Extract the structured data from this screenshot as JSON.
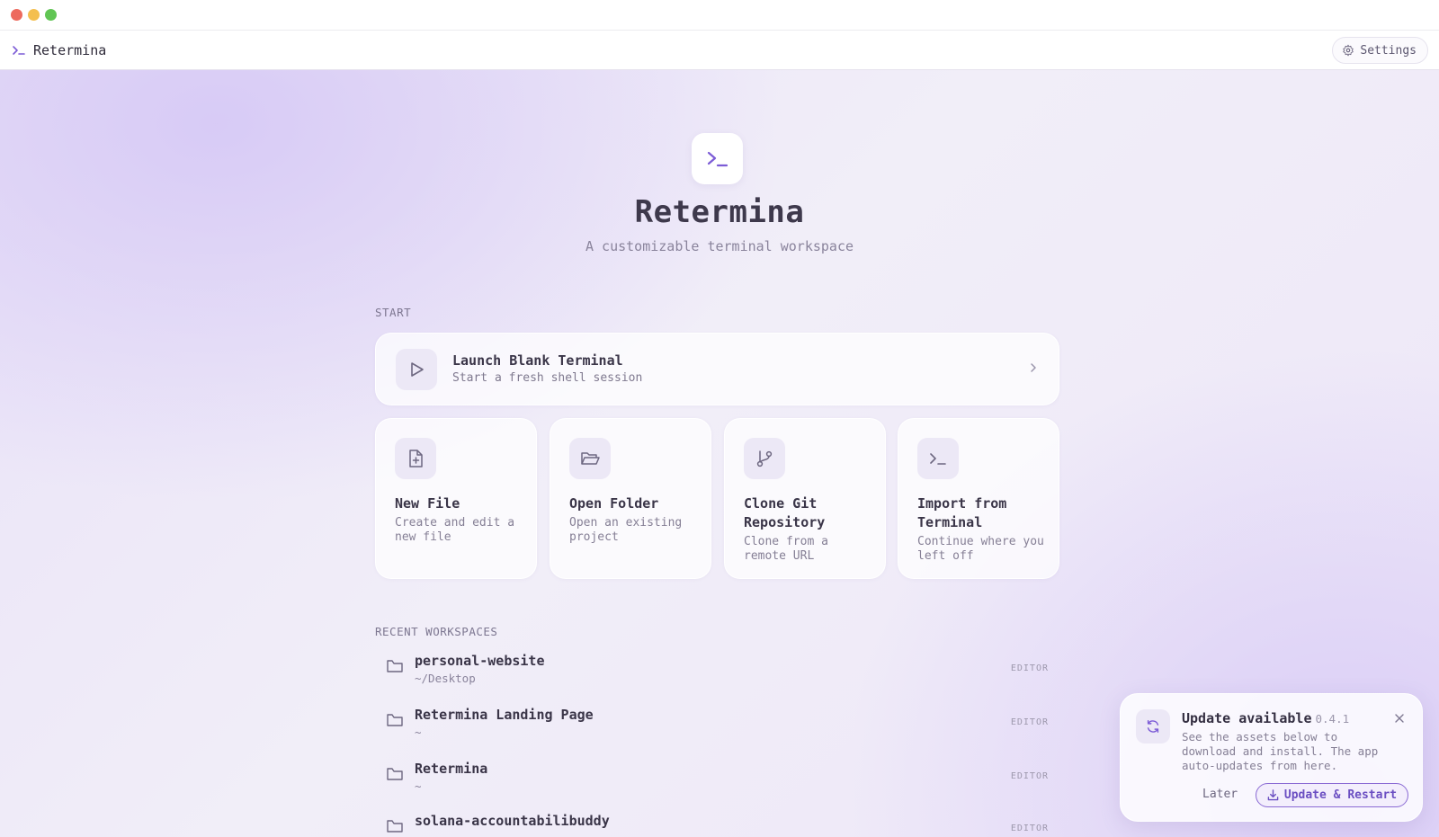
{
  "app": {
    "name": "Retermina"
  },
  "header": {
    "settings_label": "Settings"
  },
  "hero": {
    "title": "Retermina",
    "subtitle": "A customizable terminal workspace"
  },
  "start": {
    "label": "START",
    "launch": {
      "title": "Launch Blank Terminal",
      "subtitle": "Start a fresh shell session"
    },
    "actions": [
      {
        "title": "New File",
        "subtitle": "Create and edit a new file",
        "icon": "file-plus-icon"
      },
      {
        "title": "Open Folder",
        "subtitle": "Open an existing project",
        "icon": "folder-open-icon"
      },
      {
        "title": "Clone Git Repository",
        "subtitle": "Clone from a remote URL",
        "icon": "git-branch-icon"
      },
      {
        "title": "Import from Terminal",
        "subtitle": "Continue where you left off",
        "icon": "terminal-icon"
      }
    ]
  },
  "recent": {
    "label": "RECENT WORKSPACES",
    "items": [
      {
        "name": "personal-website",
        "path": "~/Desktop",
        "tag": "EDITOR"
      },
      {
        "name": "Retermina Landing Page",
        "path": "~",
        "tag": "EDITOR"
      },
      {
        "name": "Retermina",
        "path": "~",
        "tag": "EDITOR"
      },
      {
        "name": "solana-accountabilibuddy",
        "path": "",
        "tag": "EDITOR"
      }
    ]
  },
  "update_toast": {
    "title": "Update available",
    "version": "0.4.1",
    "body": "See the assets below to download and install. The app auto-updates from here.",
    "later_label": "Later",
    "update_label": "Update & Restart"
  },
  "colors": {
    "accent": "#7c5cd6",
    "background": "#ece6f8"
  }
}
